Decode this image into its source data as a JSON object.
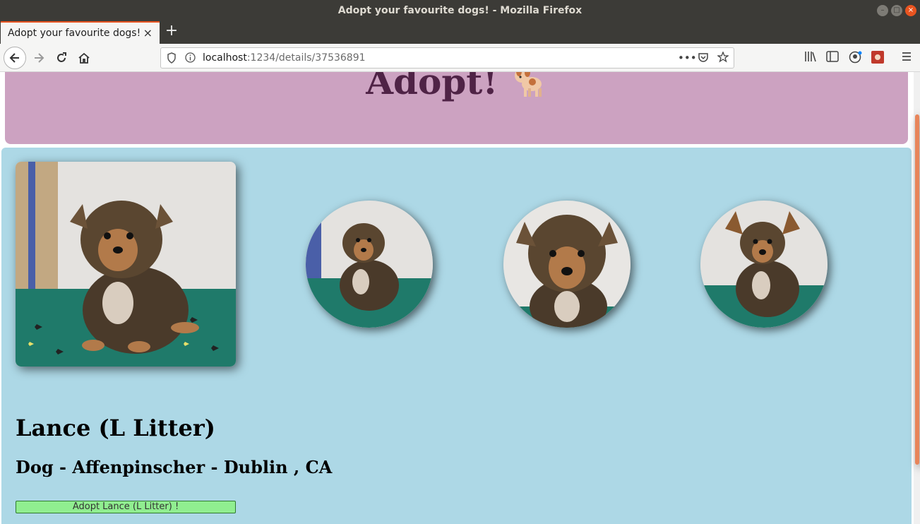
{
  "window": {
    "title": "Adopt your favourite dogs! - Mozilla Firefox"
  },
  "tab": {
    "label": "Adopt your favourite dogs!",
    "close": "×",
    "new": "+"
  },
  "nav": {
    "url_host": "localhost",
    "url_rest": ":1234/details/37536891"
  },
  "page": {
    "brand": "Adopt!",
    "pet_name": "Lance (L Litter)",
    "pet_subtitle": "Dog - Affenpinscher - Dublin , CA",
    "adopt_button": "Adopt Lance (L Litter) !"
  },
  "colors": {
    "header_bg": "#cca2c1",
    "brand_text": "#4f2346",
    "details_bg": "#add8e6",
    "adopt_button_bg": "#90ee90",
    "tab_accent": "#e95420"
  },
  "icons": [
    "back-icon",
    "forward-icon",
    "reload-icon",
    "home-icon",
    "info-icon",
    "shield-icon",
    "more-icon",
    "pocket-icon",
    "star-icon",
    "library-icon",
    "sidebar-icon",
    "account-icon",
    "extension-icon",
    "menu-icon",
    "dog-emoji"
  ]
}
